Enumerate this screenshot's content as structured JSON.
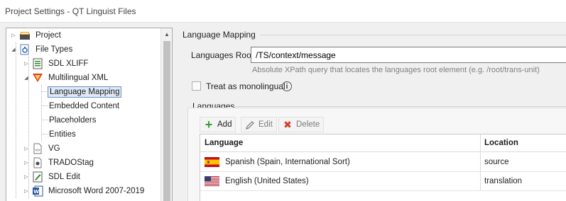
{
  "window": {
    "title": "Project Settings - QT Linguist Files"
  },
  "tree": {
    "items": [
      {
        "label": "Project",
        "icon": "project-icon"
      },
      {
        "label": "File Types",
        "icon": "file-types-icon"
      },
      {
        "label": "SDL XLIFF",
        "icon": "sdl-xliff-icon"
      },
      {
        "label": "Multilingual XML",
        "icon": "multilingual-xml-icon"
      },
      {
        "label": "Language Mapping",
        "selected": true
      },
      {
        "label": "Embedded Content"
      },
      {
        "label": "Placeholders"
      },
      {
        "label": "Entities"
      },
      {
        "label": "VG",
        "icon": "vg-file-icon"
      },
      {
        "label": "TRADOStag",
        "icon": "tradostag-icon"
      },
      {
        "label": "SDL Edit",
        "icon": "sdl-edit-icon"
      },
      {
        "label": "Microsoft Word 2007-2019",
        "icon": "word-icon"
      }
    ]
  },
  "main": {
    "section_title": "Language Mapping",
    "languages_root_label": "Languages Root:",
    "languages_root_value": "/TS/context/message",
    "languages_root_hint": "Absolute XPath query that locates the languages root element (e.g. /root/trans-unit)",
    "treat_monolingual_label": "Treat as monolingual",
    "treat_monolingual_checked": false,
    "languages_group_title": "Languages",
    "toolbar": {
      "add": "Add",
      "edit": "Edit",
      "delete": "Delete"
    },
    "grid": {
      "columns": [
        "Language",
        "Location"
      ],
      "rows": [
        {
          "language": "Spanish (Spain, International Sort)",
          "location": "source",
          "flag": "spain-flag-icon"
        },
        {
          "language": "English (United States)",
          "location": "translation",
          "flag": "usa-flag-icon"
        }
      ]
    }
  },
  "colors": {
    "selection_bg": "#dfe9f7",
    "selection_border": "#6d8fc9",
    "add_green": "#3a9a3a",
    "delete_red": "#d13b2a"
  }
}
